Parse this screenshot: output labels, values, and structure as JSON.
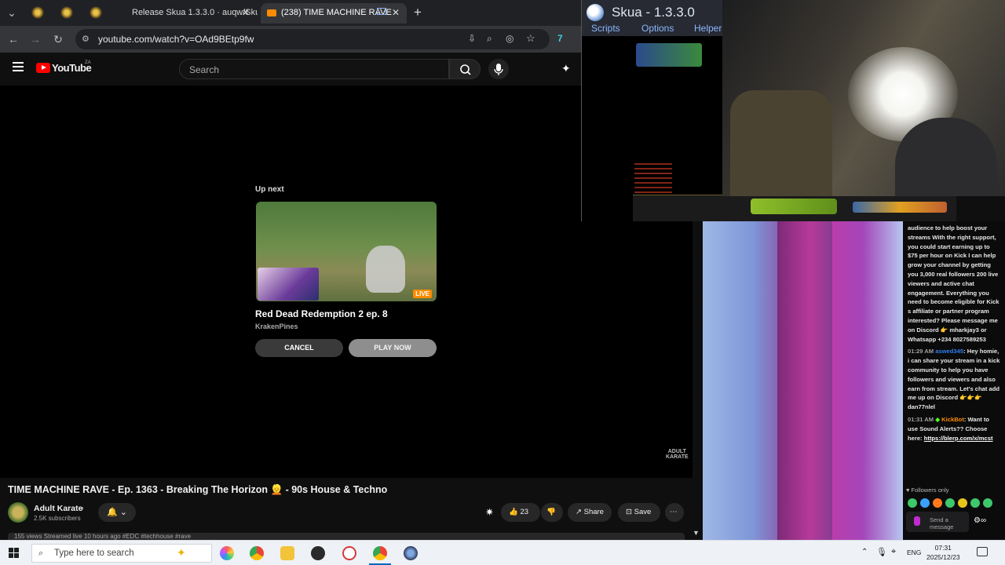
{
  "browser": {
    "tabs": [
      {
        "label": "",
        "favicon": "skua-favicon"
      },
      {
        "label": "",
        "favicon": "skua-favicon"
      },
      {
        "label": "",
        "favicon": "skua-favicon"
      },
      {
        "label": "Release Skua 1.3.3.0 · auqw/Sku",
        "active": false
      },
      {
        "label": "(238) TIME MACHINE RAVE",
        "active": true
      }
    ],
    "url": "youtube.com/watch?v=OAd9BEtp9fw"
  },
  "youtube": {
    "logo_text": "YouTube",
    "logo_region": "ZA",
    "search_placeholder": "Search",
    "upnext": {
      "label": "Up next",
      "title": "Red Dead Redemption 2 ep. 8",
      "channel": "KrakenPines",
      "live_badge": "LIVE",
      "cancel_label": "CANCEL",
      "play_label": "PLAY NOW"
    },
    "watermark_line1": "ADULT",
    "watermark_line2": "KARATE",
    "video_title": "TIME MACHINE RAVE - Ep. 1363 - Breaking The Horizon 👱 - 90s House & Techno",
    "channel_name": "Adult Karate",
    "subscribers": "2.5K subscribers",
    "likes": "23",
    "share_label": "Share",
    "save_label": "Save",
    "description_preview": "155 views  Streamed live 10 hours ago  #EDC #techhouse #rave"
  },
  "skua": {
    "title": "Skua - 1.3.3.0",
    "menu": [
      "Scripts",
      "Options",
      "Helpers"
    ]
  },
  "chat": {
    "messages": [
      {
        "time": "",
        "user": "",
        "text": "audience to help boost your streams With the right support, you could start earning up to $75 per hour on Kick I can help grow your channel by getting you 3,000 real followers 200 live viewers and active chat engagement. Everything you need to become eligible for Kick s affiliate or partner program interested? Please message me on Discord 👉 mharkjay3 or Whatsapp +234 8027589253"
      },
      {
        "time": "01:29 AM",
        "user": "aswed345",
        "text": ": Hey homie, i can share your stream in a kick community to help you have followers and viewers and also earn from stream. Let's chat add me up on Discord 👉👉👉 dan77nlel"
      },
      {
        "time": "01:31 AM",
        "user": "KickBot",
        "text": ": Want to use Sound Alerts?? Choose here:",
        "link": "https://blerp.com/x/mcst"
      }
    ],
    "followers_only": "Followers only",
    "message_placeholder": "Send a message"
  },
  "taskbar": {
    "search_placeholder": "Type here to search",
    "language": "ENG",
    "time": "07:31",
    "date": "2025/12/23"
  },
  "colors": {
    "yt_red": "#ff0000",
    "kick_green": "#53fc18",
    "chat_user_blue": "#2f7ff0",
    "live_orange": "#ff8c00"
  }
}
